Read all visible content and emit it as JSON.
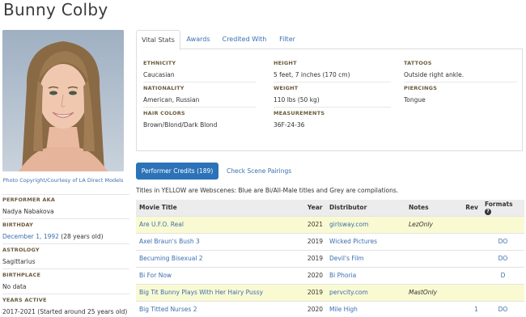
{
  "page": {
    "title": "Bunny Colby"
  },
  "photo": {
    "credit": "Photo Copyright/Courtesy of LA Direct Models"
  },
  "sidebar": {
    "aka": {
      "label": "PERFORMER AKA",
      "value": "Nadya Nabakova"
    },
    "birthday": {
      "label": "BIRTHDAY",
      "date": "December 1, 1992",
      "age": "(28 years old)"
    },
    "astrology": {
      "label": "ASTROLOGY",
      "value": "Sagittarius"
    },
    "birthplace": {
      "label": "BIRTHPLACE",
      "value": "No data"
    },
    "years_active": {
      "label": "YEARS ACTIVE",
      "value": "2017-2021 (Started around 25 years old)"
    }
  },
  "tabs": [
    "Vital Stats",
    "Awards",
    "Credited With",
    "Filter"
  ],
  "vital_stats": {
    "ethnicity": {
      "label": "ETHNICITY",
      "value": "Caucasian"
    },
    "nationality": {
      "label": "NATIONALITY",
      "value": "American, Russian"
    },
    "hair": {
      "label": "HAIR COLORS",
      "value": "Brown/Blond/Dark Blond"
    },
    "height": {
      "label": "HEIGHT",
      "value": "5 feet, 7 inches (170 cm)"
    },
    "weight": {
      "label": "WEIGHT",
      "value": "110 lbs (50 kg)"
    },
    "measurements": {
      "label": "MEASUREMENTS",
      "value": "36F-24-36"
    },
    "tattoos": {
      "label": "TATTOOS",
      "value": "Outside right ankle."
    },
    "piercings": {
      "label": "PIERCINGS",
      "value": "Tongue"
    }
  },
  "credits": {
    "button_label": "Performer Credits (189)",
    "pairings_link": "Check Scene Pairings",
    "legend": "Titles in YELLOW are Webscenes: Blue are Bi/All-Male titles and Grey are compilations.",
    "columns": {
      "title": "Movie Title",
      "year": "Year",
      "distributor": "Distributor",
      "notes": "Notes",
      "rev": "Rev",
      "formats": "Formats"
    },
    "help_icon": "question-circle-icon",
    "rows": [
      {
        "title": "Are U.F.O. Real",
        "year": "2021",
        "distributor": "girlsway.com",
        "notes": "LezOnly",
        "rev": "",
        "formats": "",
        "web": true
      },
      {
        "title": "Axel Braun's Bush 3",
        "year": "2019",
        "distributor": "Wicked Pictures",
        "notes": "",
        "rev": "",
        "formats": "DO",
        "web": false
      },
      {
        "title": "Becuming Bisexual 2",
        "year": "2019",
        "distributor": "Devil's Film",
        "notes": "",
        "rev": "",
        "formats": "DO",
        "web": false
      },
      {
        "title": "Bi For Now",
        "year": "2020",
        "distributor": "Bi Phoria",
        "notes": "",
        "rev": "",
        "formats": "D",
        "web": false
      },
      {
        "title": "Big Tit Bunny Plays With Her Hairy Pussy",
        "year": "2019",
        "distributor": "pervcity.com",
        "notes": "MastOnly",
        "rev": "",
        "formats": "",
        "web": true
      },
      {
        "title": "Big Titted Nurses 2",
        "year": "2020",
        "distributor": "Mile High",
        "notes": "",
        "rev": "1",
        "formats": "DO",
        "web": false
      }
    ]
  },
  "colors": {
    "link": "#3a6fb0",
    "button": "#2b72b8",
    "webscene_row": "#fafad2",
    "header_bg": "#ececec",
    "label": "#6b5a3c"
  }
}
